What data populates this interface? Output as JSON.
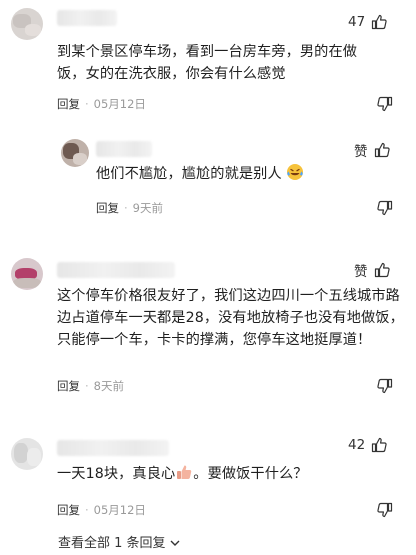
{
  "comments": [
    {
      "text": "到某个景区停车场，看到一台房车旁，男的在做饭，女的在洗衣服，你会有什么感觉",
      "reply_label": "回复",
      "date": "05月12日",
      "likes": "47"
    },
    {
      "text": "他们不尴尬，尴尬的就是别人",
      "reply_label": "回复",
      "date": "9天前",
      "likes": "赞",
      "emoji": "laughing-crying-face"
    },
    {
      "text": "这个停车价格很友好了，我们这边四川一个五线城市路边占道停车一天都是28，没有地放椅子也没有地做饭，只能停一个车，卡卡的撑满，您停车这地挺厚道！",
      "reply_label": "回复",
      "date": "8天前",
      "likes": "赞"
    },
    {
      "text_before": "一天18块，真良心",
      "text_after": "。要做饭干什么？",
      "emoji": "thumbs-up",
      "reply_label": "回复",
      "date": "05月12日",
      "likes": "42"
    }
  ],
  "footer": {
    "view_all": "查看全部 1 条回复",
    "chevron": "chevron-down-icon"
  },
  "colors": {
    "text": "#1f1f1f",
    "meta": "#9a9a9a",
    "avatar_bg": "#d9d4d1"
  }
}
